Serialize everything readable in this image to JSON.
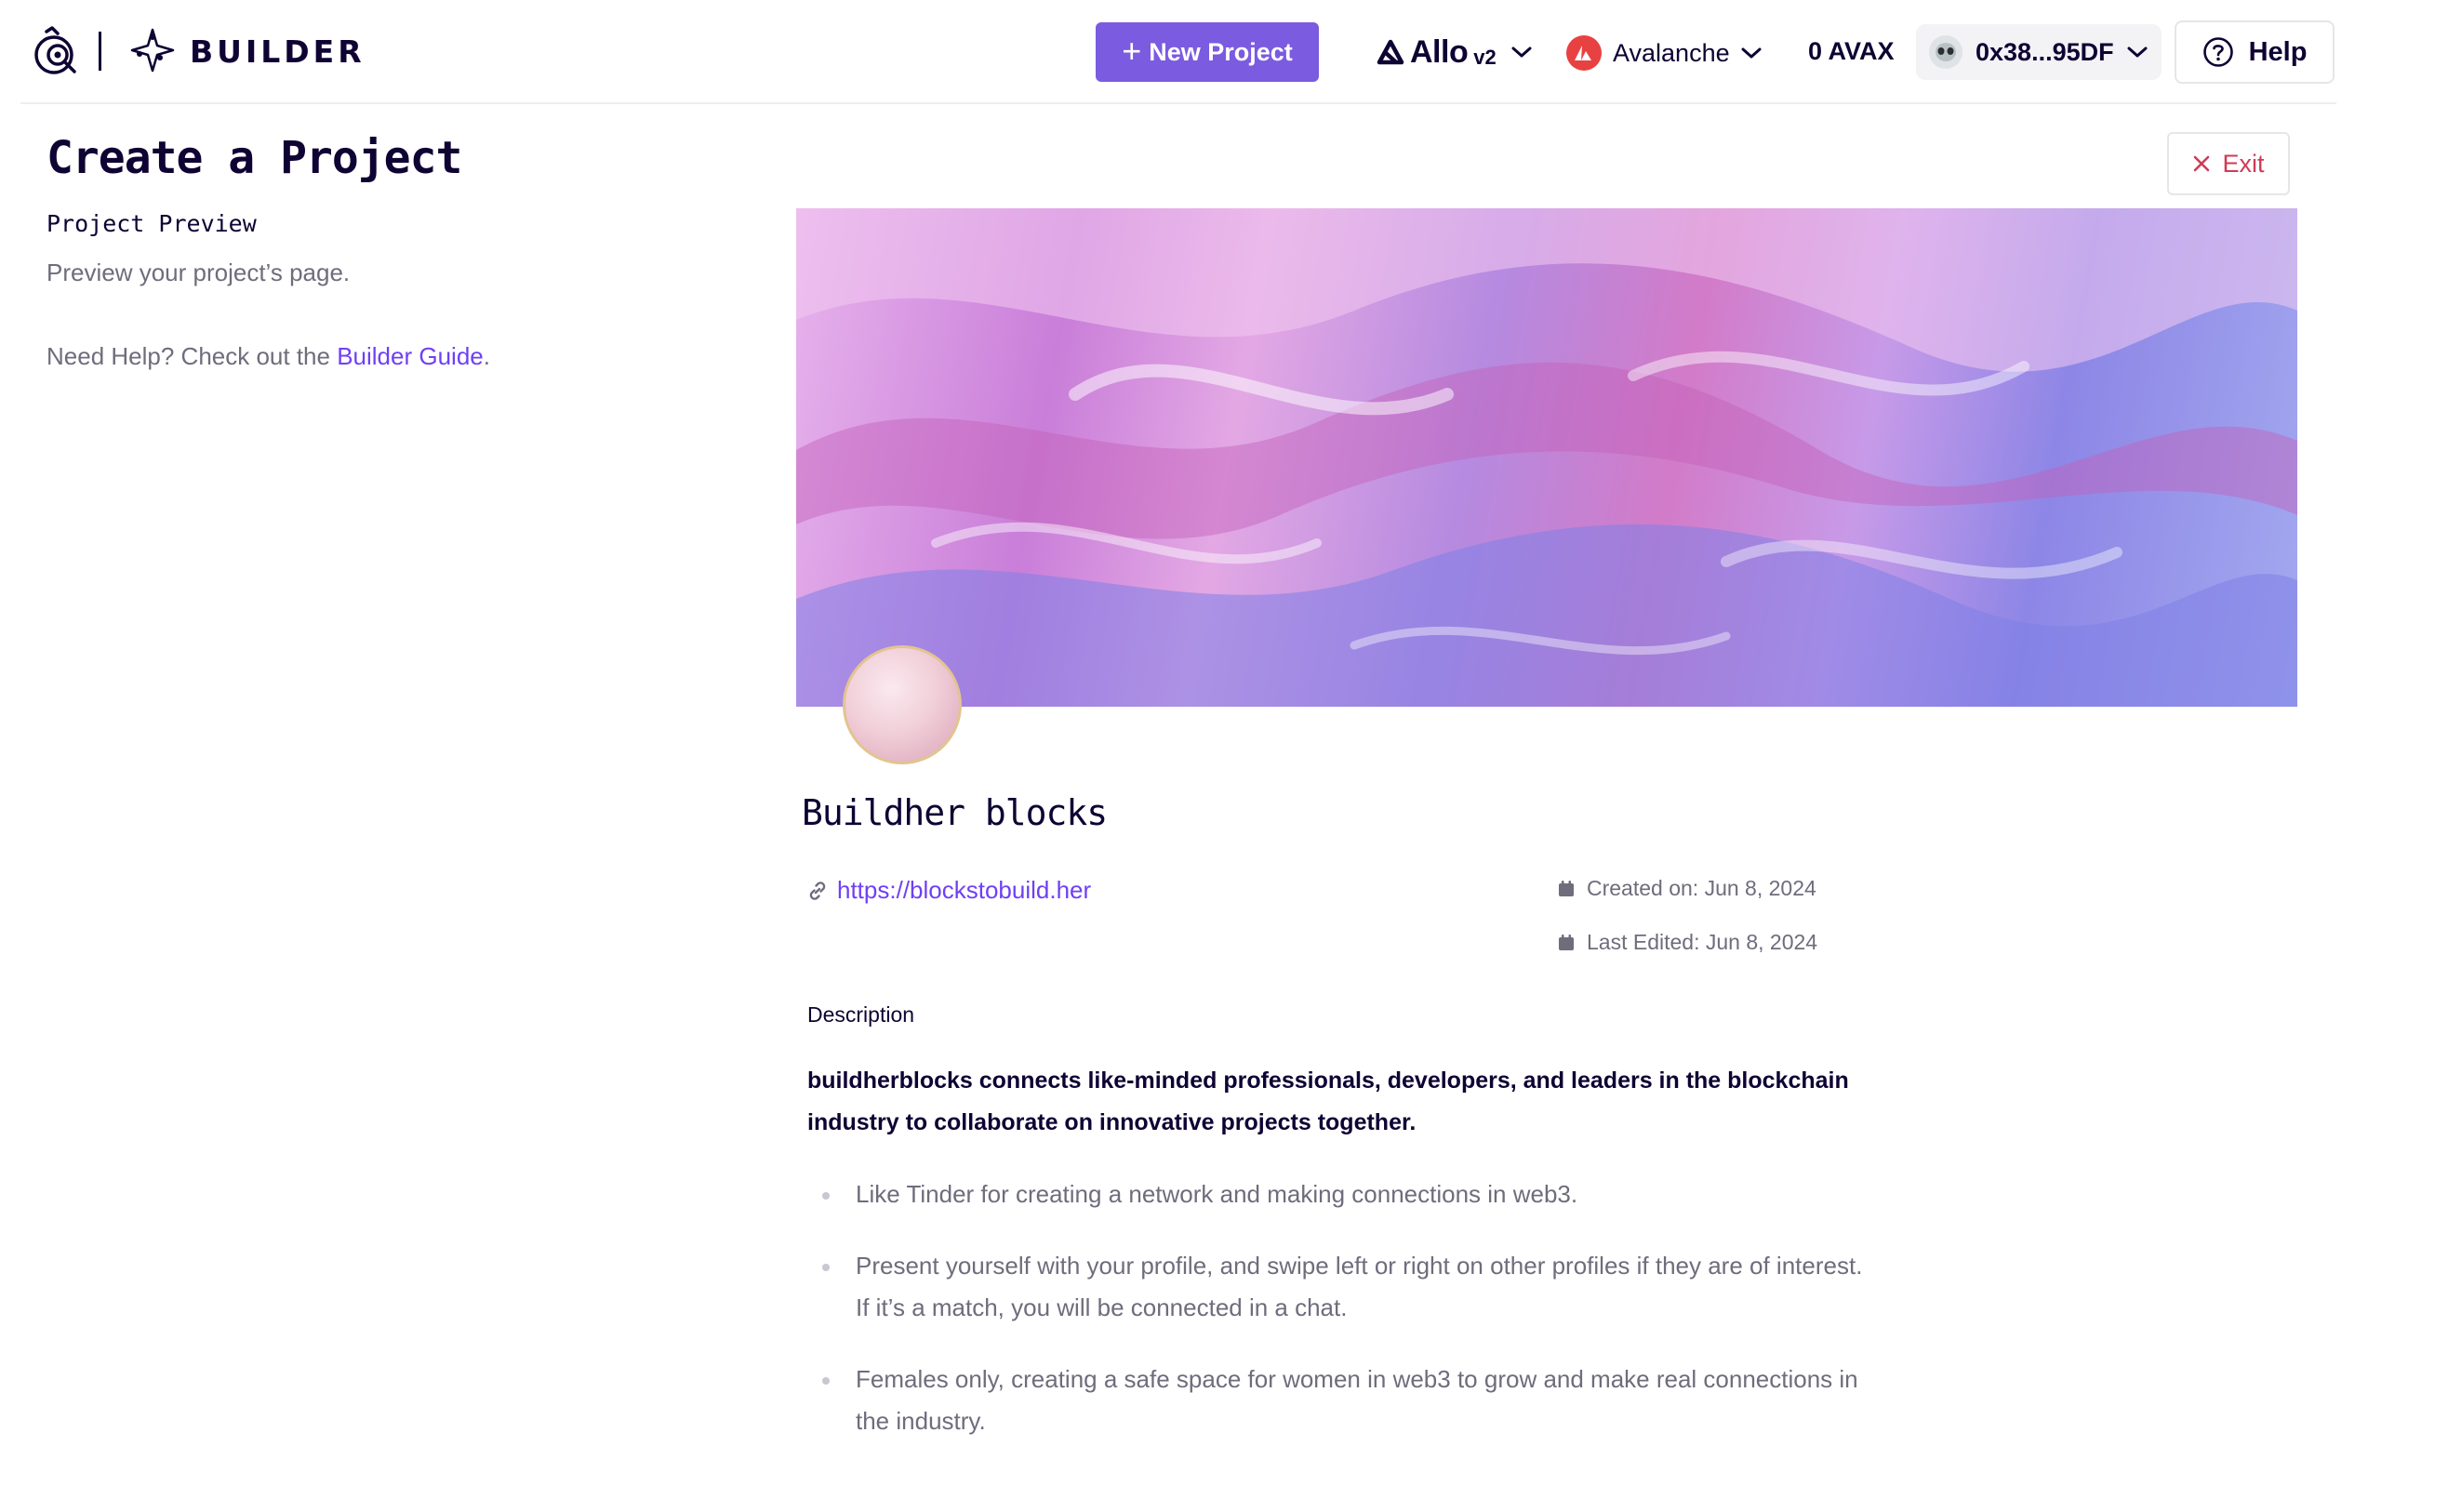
{
  "header": {
    "brand": "BUILDER",
    "new_project_label": "New Project",
    "allo": {
      "name": "Allo",
      "version": "v2"
    },
    "network": "Avalanche",
    "balance": "0 AVAX",
    "wallet_address": "0x38...95DF",
    "help_label": "Help"
  },
  "left": {
    "title": "Create a Project",
    "section_title": "Project Preview",
    "section_subtitle": "Preview your project’s page.",
    "help_prefix": "Need Help? Check out the ",
    "help_link": "Builder Guide",
    "help_suffix": "."
  },
  "exit_label": "Exit",
  "preview": {
    "project_name": "Buildher blocks",
    "website": "https://blockstobuild.her",
    "created_on": "Created on: Jun 8, 2024",
    "last_edited": "Last Edited: Jun 8, 2024",
    "description_label": "Description",
    "description_lead": "buildherblocks connects like-minded professionals, developers, and leaders in the blockchain industry to collaborate on innovative projects together.",
    "bullets": [
      "Like Tinder for creating a network and making connections in web3.",
      "Present yourself with your profile, and swipe left or right on other profiles if they are of interest. If it’s a match, you will be connected in a chat.",
      "Females only, creating a safe space for women in web3 to grow and make real connections in the industry."
    ]
  },
  "colors": {
    "primary": "#7b5be0",
    "link": "#6f3ff5",
    "exit": "#d03a54",
    "avalanche": "#e84142",
    "text": "#0e0333",
    "muted": "#6f6c7c"
  },
  "icons": [
    "gitcoin-logo-icon",
    "builder-logo-icon",
    "allo-logo-icon",
    "avalanche-icon",
    "wallet-avatar-icon",
    "help-circle-icon",
    "close-icon",
    "link-icon",
    "calendar-icon",
    "chevron-down-icon"
  ]
}
